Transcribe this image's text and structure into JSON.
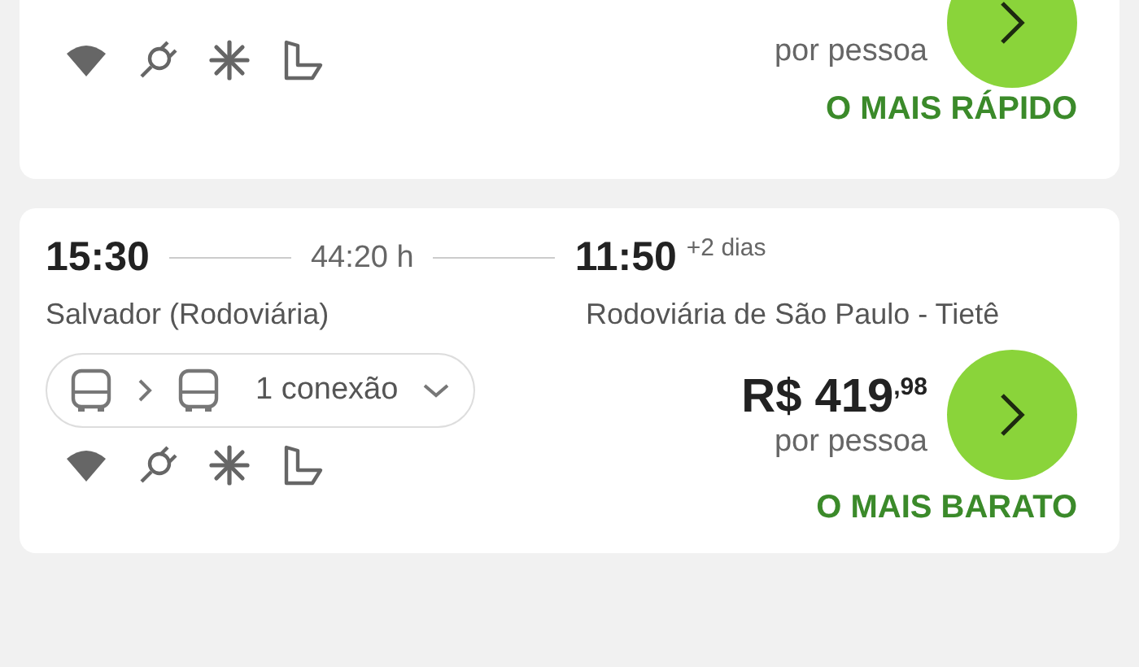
{
  "results": [
    {
      "per_person": "por pessoa",
      "badge": "O MAIS RÁPIDO"
    },
    {
      "departure": "15:30",
      "duration": "44:20 h",
      "arrival": "11:50",
      "arrival_offset": "+2 dias",
      "origin": "Salvador (Rodoviária)",
      "destination": "Rodoviária de São Paulo - Tietê",
      "connection": "1 conexão",
      "price": "R$ 419$^{,98}$",
      "per_person": "por pessoa",
      "badge": "O MAIS BARATO"
    }
  ]
}
